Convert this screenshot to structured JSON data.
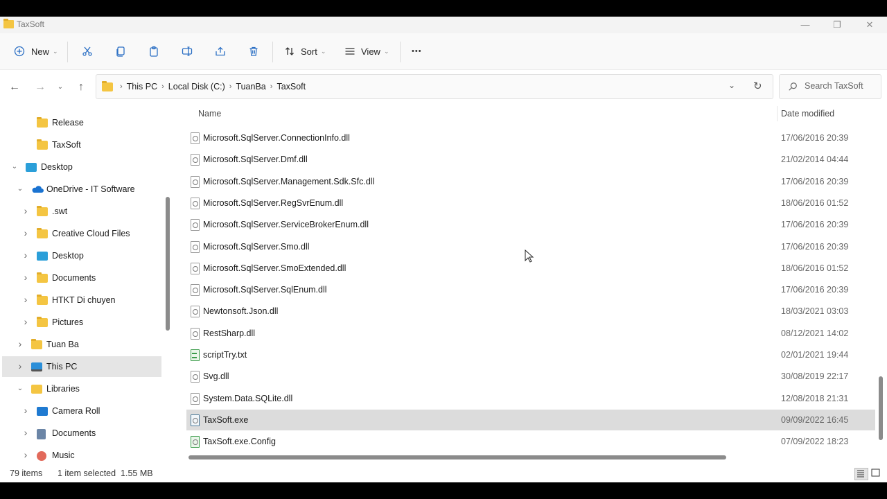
{
  "window": {
    "title": "TaxSoft"
  },
  "toolbar": {
    "new_label": "New",
    "sort_label": "Sort",
    "view_label": "View",
    "more_label": "•••"
  },
  "address": {
    "crumbs": [
      "This PC",
      "Local Disk (C:)",
      "TuanBa",
      "TaxSoft"
    ]
  },
  "search": {
    "placeholder": "Search TaxSoft"
  },
  "sidebar": {
    "items": [
      {
        "label": "Release",
        "icon": "folder-icon",
        "indent": 2,
        "expander": ""
      },
      {
        "label": "TaxSoft",
        "icon": "folder-icon",
        "indent": 2,
        "expander": ""
      },
      {
        "label": "Desktop",
        "icon": "desktop-icon",
        "indent": 0,
        "expander": "down"
      },
      {
        "label": "OneDrive - IT Software",
        "icon": "onedrive-icon",
        "indent": 1,
        "expander": "down"
      },
      {
        "label": ".swt",
        "icon": "folder-icon",
        "indent": 2,
        "expander": "right"
      },
      {
        "label": "Creative Cloud Files",
        "icon": "folder-icon",
        "indent": 2,
        "expander": "right"
      },
      {
        "label": "Desktop",
        "icon": "desktop-icon",
        "indent": 2,
        "expander": "right"
      },
      {
        "label": "Documents",
        "icon": "folder-icon",
        "indent": 2,
        "expander": "right"
      },
      {
        "label": "HTKT Di chuyen",
        "icon": "folder-icon",
        "indent": 2,
        "expander": "right"
      },
      {
        "label": "Pictures",
        "icon": "folder-icon",
        "indent": 2,
        "expander": "right"
      },
      {
        "label": "Tuan Ba",
        "icon": "folder-icon",
        "indent": 1,
        "expander": "right"
      },
      {
        "label": "This PC",
        "icon": "this-pc-icon",
        "indent": 1,
        "expander": "right",
        "selected": true
      },
      {
        "label": "Libraries",
        "icon": "libraries-icon",
        "indent": 1,
        "expander": "down"
      },
      {
        "label": "Camera Roll",
        "icon": "camera-roll-icon",
        "indent": 2,
        "expander": "right"
      },
      {
        "label": "Documents",
        "icon": "documents-icon",
        "indent": 2,
        "expander": "right"
      },
      {
        "label": "Music",
        "icon": "music-icon",
        "indent": 2,
        "expander": "right"
      }
    ]
  },
  "columns": {
    "name": "Name",
    "date": "Date modified"
  },
  "files": [
    {
      "name": "Microsoft.SqlServer.ConnectionInfo.dll",
      "date": "17/06/2016 20:39",
      "type": "dll"
    },
    {
      "name": "Microsoft.SqlServer.Dmf.dll",
      "date": "21/02/2014 04:44",
      "type": "dll"
    },
    {
      "name": "Microsoft.SqlServer.Management.Sdk.Sfc.dll",
      "date": "17/06/2016 20:39",
      "type": "dll"
    },
    {
      "name": "Microsoft.SqlServer.RegSvrEnum.dll",
      "date": "18/06/2016 01:52",
      "type": "dll"
    },
    {
      "name": "Microsoft.SqlServer.ServiceBrokerEnum.dll",
      "date": "17/06/2016 20:39",
      "type": "dll"
    },
    {
      "name": "Microsoft.SqlServer.Smo.dll",
      "date": "17/06/2016 20:39",
      "type": "dll"
    },
    {
      "name": "Microsoft.SqlServer.SmoExtended.dll",
      "date": "18/06/2016 01:52",
      "type": "dll"
    },
    {
      "name": "Microsoft.SqlServer.SqlEnum.dll",
      "date": "17/06/2016 20:39",
      "type": "dll"
    },
    {
      "name": "Newtonsoft.Json.dll",
      "date": "18/03/2021 03:03",
      "type": "dll"
    },
    {
      "name": "RestSharp.dll",
      "date": "08/12/2021 14:02",
      "type": "dll"
    },
    {
      "name": "scriptTry.txt",
      "date": "02/01/2021 19:44",
      "type": "txt"
    },
    {
      "name": "Svg.dll",
      "date": "30/08/2019 22:17",
      "type": "dll"
    },
    {
      "name": "System.Data.SQLite.dll",
      "date": "12/08/2018 21:31",
      "type": "dll"
    },
    {
      "name": "TaxSoft.exe",
      "date": "09/09/2022 16:45",
      "type": "exe",
      "selected": true
    },
    {
      "name": "TaxSoft.exe.Config",
      "date": "07/09/2022 18:23",
      "type": "config"
    }
  ],
  "status": {
    "item_count": "79 items",
    "selection": "1 item selected  1.55 MB"
  },
  "colors": {
    "accent": "#2b6fc4",
    "selected_row": "#dcdcdc",
    "selected_nav": "#e5e5e5"
  }
}
